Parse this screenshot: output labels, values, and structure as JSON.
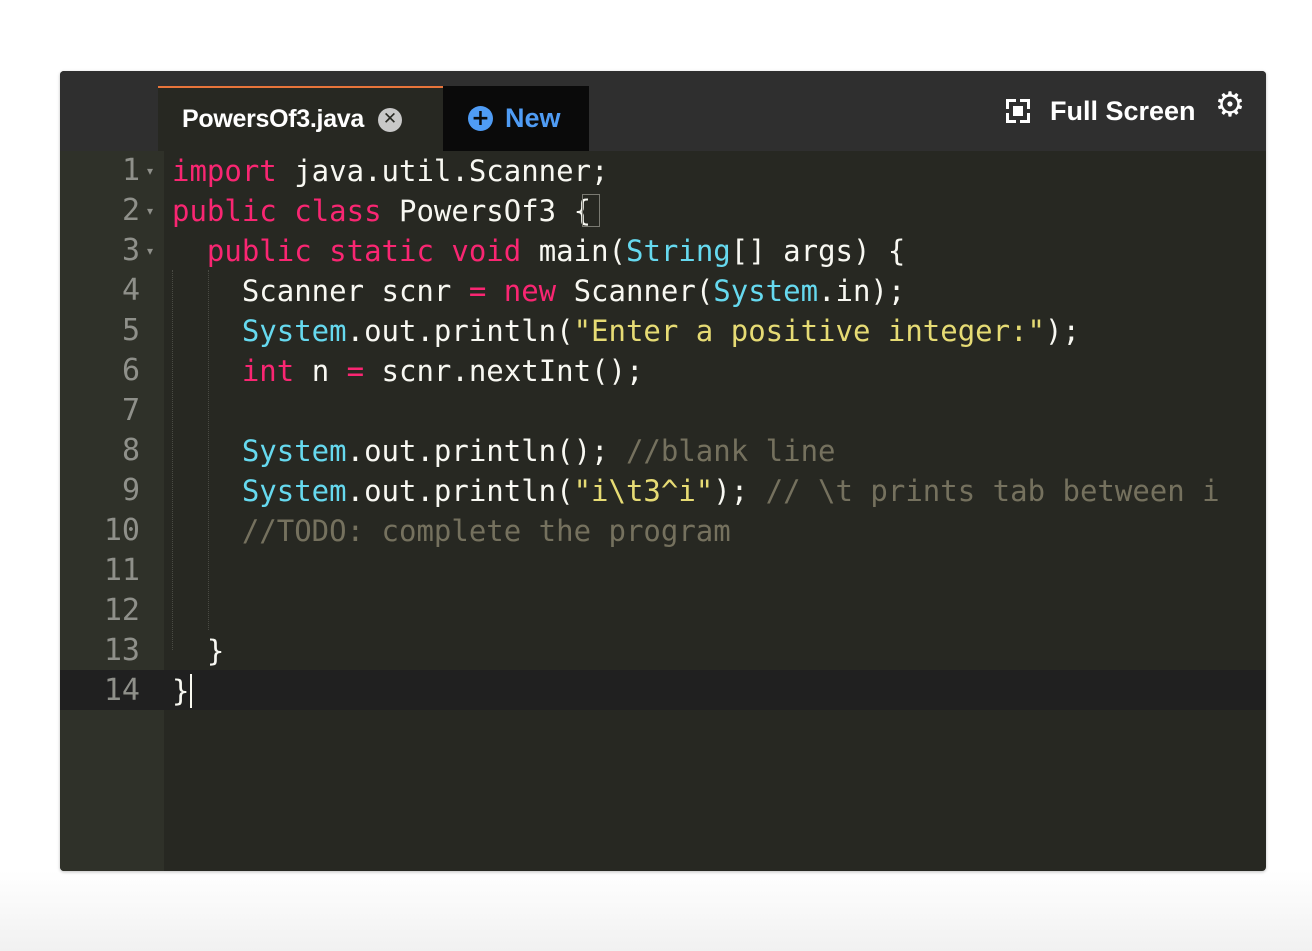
{
  "tabs": {
    "file_name": "PowersOf3.java",
    "close_icon": "close-icon",
    "new_label": "New",
    "new_icon": "plus-circle-icon"
  },
  "toolbar": {
    "fullscreen_label": "Full Screen",
    "fullscreen_icon": "fullscreen-icon",
    "settings_icon": "gear-icon"
  },
  "colors": {
    "editor_background": "#272822",
    "keyword": "#f92672",
    "type": "#66d9ef",
    "string": "#e6db74",
    "comment": "#75715e",
    "tab_accent": "#e8743b",
    "new_button": "#4f9cf5"
  },
  "editor": {
    "active_line": 14,
    "lines": [
      {
        "num": "1",
        "fold": true,
        "tokens": [
          {
            "t": "import",
            "c": "kw"
          },
          {
            "t": " java.util.Scanner;",
            "c": ""
          }
        ]
      },
      {
        "num": "2",
        "fold": true,
        "tokens": [
          {
            "t": "public",
            "c": "kw"
          },
          {
            "t": " ",
            "c": ""
          },
          {
            "t": "class",
            "c": "kw"
          },
          {
            "t": " PowersOf3 {",
            "c": ""
          }
        ]
      },
      {
        "num": "3",
        "fold": true,
        "tokens": [
          {
            "t": "  ",
            "c": ""
          },
          {
            "t": "public",
            "c": "kw"
          },
          {
            "t": " ",
            "c": ""
          },
          {
            "t": "static",
            "c": "kw"
          },
          {
            "t": " ",
            "c": ""
          },
          {
            "t": "void",
            "c": "kw"
          },
          {
            "t": " main(",
            "c": ""
          },
          {
            "t": "String",
            "c": "ty"
          },
          {
            "t": "[] args) {",
            "c": ""
          }
        ]
      },
      {
        "num": "4",
        "fold": false,
        "tokens": [
          {
            "t": "    Scanner scnr ",
            "c": ""
          },
          {
            "t": "=",
            "c": "kw"
          },
          {
            "t": " ",
            "c": ""
          },
          {
            "t": "new",
            "c": "kw"
          },
          {
            "t": " Scanner(",
            "c": ""
          },
          {
            "t": "System",
            "c": "ty"
          },
          {
            "t": ".in);",
            "c": ""
          }
        ]
      },
      {
        "num": "5",
        "fold": false,
        "tokens": [
          {
            "t": "    ",
            "c": ""
          },
          {
            "t": "System",
            "c": "ty"
          },
          {
            "t": ".out.println(",
            "c": ""
          },
          {
            "t": "\"Enter a positive integer:\"",
            "c": "st"
          },
          {
            "t": ");",
            "c": ""
          }
        ]
      },
      {
        "num": "6",
        "fold": false,
        "tokens": [
          {
            "t": "    ",
            "c": ""
          },
          {
            "t": "int",
            "c": "kw"
          },
          {
            "t": " n ",
            "c": ""
          },
          {
            "t": "=",
            "c": "kw"
          },
          {
            "t": " scnr.nextInt();",
            "c": ""
          }
        ]
      },
      {
        "num": "7",
        "fold": false,
        "tokens": []
      },
      {
        "num": "8",
        "fold": false,
        "tokens": [
          {
            "t": "    ",
            "c": ""
          },
          {
            "t": "System",
            "c": "ty"
          },
          {
            "t": ".out.println(); ",
            "c": ""
          },
          {
            "t": "//blank line",
            "c": "cm"
          }
        ]
      },
      {
        "num": "9",
        "fold": false,
        "tokens": [
          {
            "t": "    ",
            "c": ""
          },
          {
            "t": "System",
            "c": "ty"
          },
          {
            "t": ".out.println(",
            "c": ""
          },
          {
            "t": "\"i\\t3^i\"",
            "c": "st"
          },
          {
            "t": "); ",
            "c": ""
          },
          {
            "t": "// \\t prints tab between i",
            "c": "cm"
          }
        ]
      },
      {
        "num": "10",
        "fold": false,
        "tokens": [
          {
            "t": "    ",
            "c": ""
          },
          {
            "t": "//TODO: complete the program",
            "c": "cm"
          }
        ]
      },
      {
        "num": "11",
        "fold": false,
        "tokens": []
      },
      {
        "num": "12",
        "fold": false,
        "tokens": []
      },
      {
        "num": "13",
        "fold": false,
        "tokens": [
          {
            "t": "  }",
            "c": ""
          }
        ]
      },
      {
        "num": "14",
        "fold": false,
        "tokens": [
          {
            "t": "}",
            "c": ""
          }
        ]
      }
    ]
  }
}
